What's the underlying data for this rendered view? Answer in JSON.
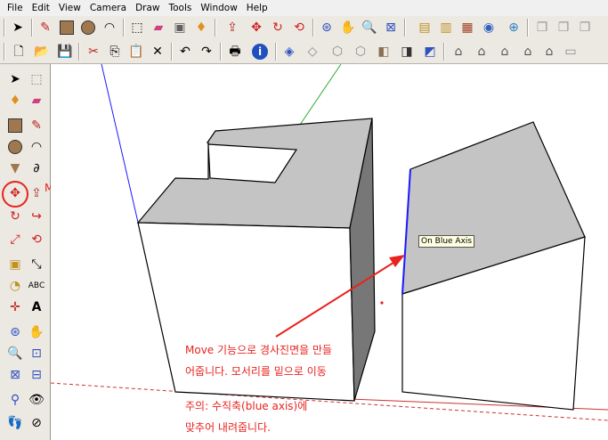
{
  "menu": [
    "File",
    "Edit",
    "View",
    "Camera",
    "Draw",
    "Tools",
    "Window",
    "Help"
  ],
  "callout_label": "Move",
  "tooltip": "On Blue Axis",
  "annotation": {
    "line1": "Move 기능으로 경사진면을 만들",
    "line2": "어줍니다. 모서리를 밑으로 이동",
    "line3": "주의: 수직축(blue axis)에",
    "line4": "맞추어 내려줍니다."
  },
  "colors": {
    "annotation": "#e8231f",
    "blue_axis": "#1a1aff",
    "green_axis": "#2eaa2e",
    "red_axis": "#cc3333"
  }
}
